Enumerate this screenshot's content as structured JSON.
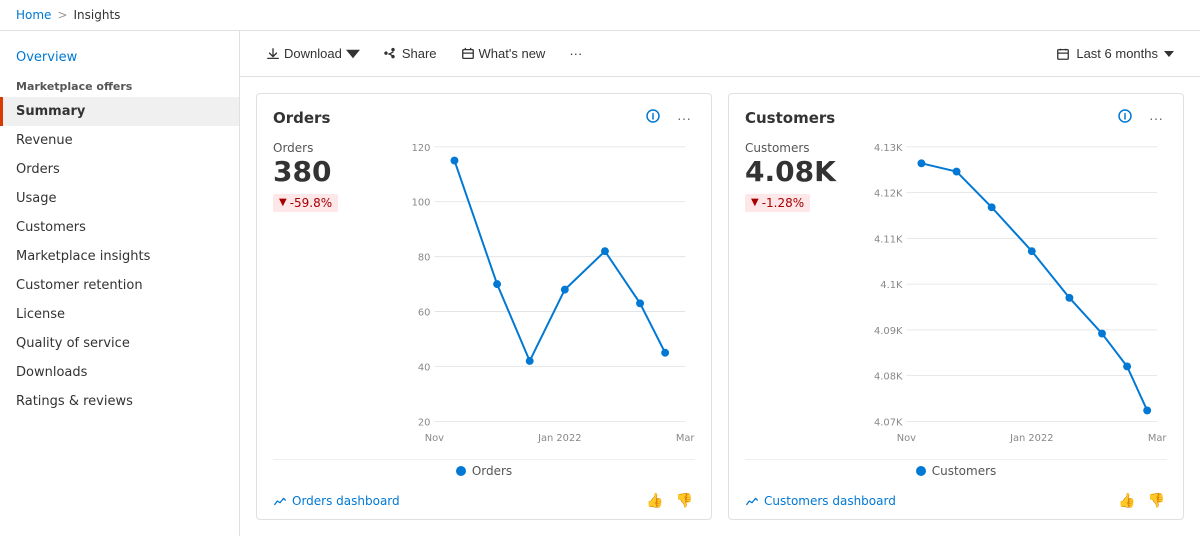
{
  "breadcrumb": {
    "home": "Home",
    "separator": ">",
    "current": "Insights"
  },
  "sidebar": {
    "overview_label": "Overview",
    "section_label": "Marketplace offers",
    "items": [
      {
        "id": "summary",
        "label": "Summary",
        "active": true
      },
      {
        "id": "revenue",
        "label": "Revenue",
        "active": false
      },
      {
        "id": "orders",
        "label": "Orders",
        "active": false
      },
      {
        "id": "usage",
        "label": "Usage",
        "active": false
      },
      {
        "id": "customers",
        "label": "Customers",
        "active": false
      },
      {
        "id": "marketplace-insights",
        "label": "Marketplace insights",
        "active": false
      },
      {
        "id": "customer-retention",
        "label": "Customer retention",
        "active": false
      },
      {
        "id": "license",
        "label": "License",
        "active": false
      },
      {
        "id": "quality-of-service",
        "label": "Quality of service",
        "active": false
      },
      {
        "id": "downloads",
        "label": "Downloads",
        "active": false
      },
      {
        "id": "ratings-reviews",
        "label": "Ratings & reviews",
        "active": false
      }
    ]
  },
  "toolbar": {
    "download_label": "Download",
    "share_label": "Share",
    "whats_new_label": "What's new",
    "more_label": "···",
    "period_label": "Last 6 months"
  },
  "cards": [
    {
      "id": "orders",
      "title": "Orders",
      "stat_label": "Orders",
      "stat_value": "380",
      "stat_change": "-59.8%",
      "legend_label": "Orders",
      "link_label": "Orders dashboard",
      "chart": {
        "x_labels": [
          "Nov",
          "Jan 2022",
          "Mar"
        ],
        "y_labels": [
          "20",
          "40",
          "60",
          "80",
          "100",
          "120"
        ],
        "points": [
          {
            "x": 0.08,
            "y": 0.05
          },
          {
            "x": 0.25,
            "y": 0.5
          },
          {
            "x": 0.38,
            "y": 0.78
          },
          {
            "x": 0.52,
            "y": 0.52
          },
          {
            "x": 0.68,
            "y": 0.38
          },
          {
            "x": 0.82,
            "y": 0.57
          },
          {
            "x": 0.92,
            "y": 0.75
          }
        ]
      }
    },
    {
      "id": "customers",
      "title": "Customers",
      "stat_label": "Customers",
      "stat_value": "4.08K",
      "stat_change": "-1.28%",
      "legend_label": "Customers",
      "link_label": "Customers dashboard",
      "chart": {
        "x_labels": [
          "Nov",
          "Jan 2022",
          "Mar"
        ],
        "y_labels": [
          "4.07K",
          "4.08K",
          "4.09K",
          "4.1K",
          "4.11K",
          "4.12K",
          "4.13K"
        ],
        "points": [
          {
            "x": 0.06,
            "y": 0.06
          },
          {
            "x": 0.2,
            "y": 0.09
          },
          {
            "x": 0.34,
            "y": 0.22
          },
          {
            "x": 0.5,
            "y": 0.38
          },
          {
            "x": 0.65,
            "y": 0.55
          },
          {
            "x": 0.78,
            "y": 0.68
          },
          {
            "x": 0.88,
            "y": 0.8
          },
          {
            "x": 0.96,
            "y": 0.96
          }
        ]
      }
    }
  ]
}
